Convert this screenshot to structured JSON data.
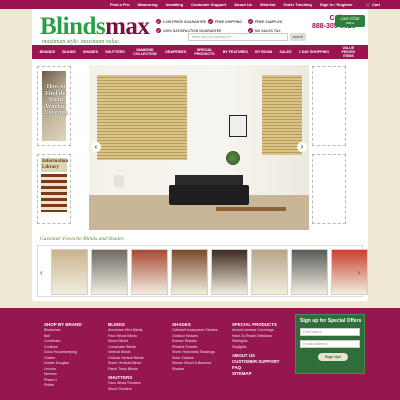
{
  "topbar": {
    "links": [
      "Find a Pro",
      "Measuring",
      "Installing",
      "Customer Support",
      "About Us",
      "Wishlist",
      "Order Tracking",
      "Sign In / Register"
    ],
    "cart_label": "Cart"
  },
  "header": {
    "logo_part1": "Blinds",
    "logo_part2": "max",
    "tagline": "maximum style. maximum value.",
    "benefits": [
      "LOW PRICE GUARANTEE",
      "FREE SHIPPING",
      "FREE SAMPLES",
      "100% SATISFACTION GUARANTEE",
      "NO SALES TAX"
    ],
    "search_placeholder": "What are you looking for?",
    "search_button": "search",
    "call_label": "Call Us!",
    "phone": "888-305-8020",
    "live_chat": "Live Chat",
    "live_chat_status": "Offline"
  },
  "nav": {
    "items": [
      "BRANDS",
      "BLINDS",
      "SHADES",
      "SHUTTERS",
      "DIAMOND COLLECTION",
      "DRAPERIES",
      "SPECIAL PRODUCTS",
      "BY FEATURES",
      "BY ROOM",
      "SALES",
      "1 DAY SHOPPING",
      "VALUE PRICED ITEMS"
    ]
  },
  "hero": {
    "how_to": "How to Find the Right Window Covering",
    "library": "Information Library",
    "prev": "‹",
    "next": "›"
  },
  "favorites": {
    "title": "Customer Favorite Blinds and Shades",
    "prev": "‹",
    "next": "›",
    "thumb_colors": [
      "#c9b48f",
      "#6f6a62",
      "#a84b35",
      "#7a4a2a",
      "#3e2a20",
      "#b7a587",
      "#5b5b5b",
      "#c7412e"
    ]
  },
  "footer": {
    "shop_by_brand": {
      "title": "SHOP BY BRAND",
      "items": [
        "Blindsmax",
        "Bali",
        "Comfortex",
        "Coulisse",
        "Good Housekeeping",
        "Graber",
        "Hunter Douglas",
        "Levolor",
        "Norman",
        "Phase II",
        "Philter"
      ]
    },
    "blinds": {
      "title": "BLINDS",
      "items": [
        "Aluminum Mini Blinds",
        "Faux Wood Blinds",
        "Wood Blinds",
        "Composite Blinds",
        "Vertical Blinds",
        "Cellular Vertical Blinds",
        "Sheer Vertical Blinds",
        "Panel Track Blinds"
      ]
    },
    "shutters": {
      "title": "SHUTTERS",
      "items": [
        "Faux Wood Shutters",
        "Wood Shutters"
      ]
    },
    "shades": {
      "title": "SHADES",
      "items": [
        "Cellular/Honeycomb Shades",
        "Outdoor Shades",
        "Roman Shades",
        "Pleated Shades",
        "Sheer Horizontal Shadings",
        "Solar Shades",
        "Woven Wood & Bamboo",
        "Shades"
      ]
    },
    "special": {
      "title": "SPECIAL PRODUCTS",
      "items": [
        "Arched window Coverings",
        "Hard-To-Reach Windows",
        "Sidelights",
        "Skylights"
      ]
    },
    "links": [
      "ABOUT US",
      "CUSTOMER SUPPORT",
      "FAQ",
      "SITEMAP"
    ],
    "signup": {
      "title": "Sign up for Special Offers",
      "first_name": "First Name",
      "email": "Email Address",
      "button": "Sign Up!"
    }
  }
}
